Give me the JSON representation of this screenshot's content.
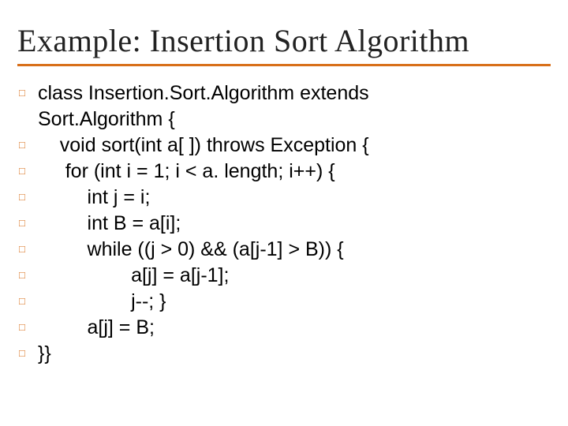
{
  "title": "Example: Insertion Sort Algorithm",
  "lines": [
    {
      "bullet": true,
      "text": "class Insertion.Sort.Algorithm extends"
    },
    {
      "bullet": false,
      "text": "Sort.Algorithm {"
    },
    {
      "bullet": true,
      "text": "    void sort(int a[ ]) throws Exception {"
    },
    {
      "bullet": true,
      "text": "     for (int i = 1; i < a. length; i++) {"
    },
    {
      "bullet": true,
      "text": "         int j = i;"
    },
    {
      "bullet": true,
      "text": "         int B = a[i];"
    },
    {
      "bullet": true,
      "text": "         while ((j > 0) && (a[j-1] > B)) {"
    },
    {
      "bullet": true,
      "text": "                 a[j] = a[j-1];"
    },
    {
      "bullet": true,
      "text": "                 j--; }"
    },
    {
      "bullet": true,
      "text": "         a[j] = B;"
    },
    {
      "bullet": true,
      "text": "}}"
    }
  ]
}
